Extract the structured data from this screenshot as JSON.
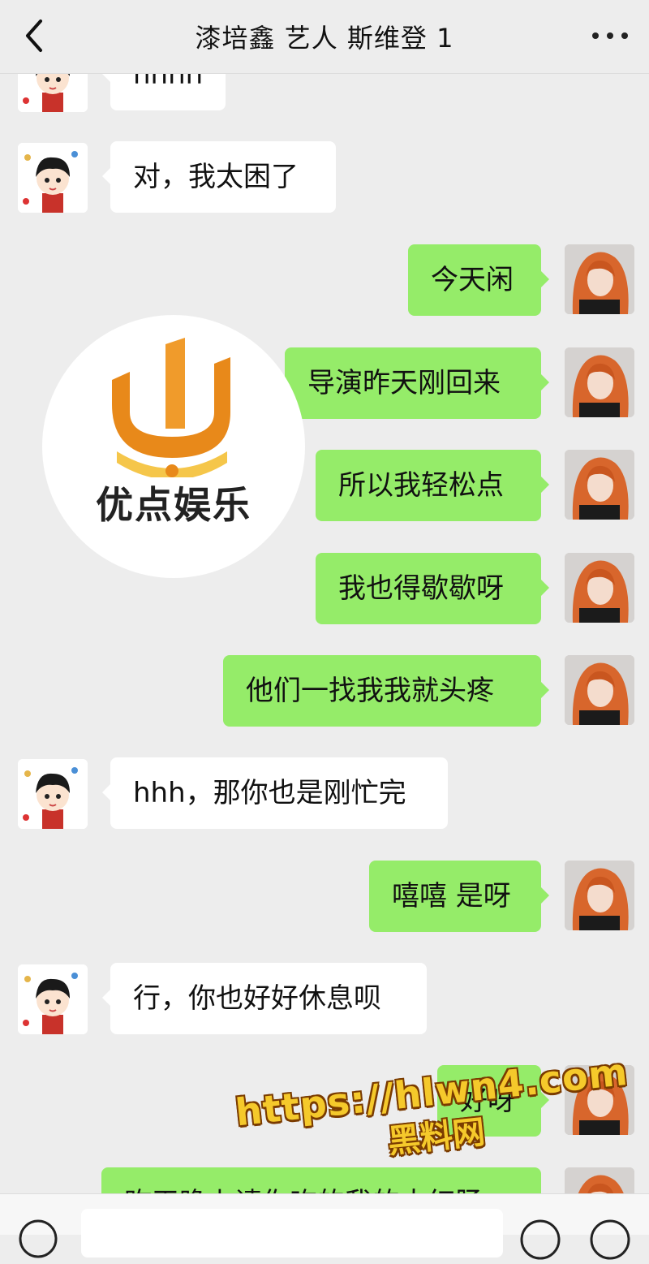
{
  "header": {
    "title": "漆培鑫 艺人 斯维登 1",
    "back_icon": "chevron-left-icon",
    "more_icon": "more-dots-icon"
  },
  "messages": [
    {
      "side": "in",
      "text": "hhhh"
    },
    {
      "side": "in",
      "text": "对，我太困了"
    },
    {
      "side": "out",
      "text": "今天闲"
    },
    {
      "side": "out",
      "text": "导演昨天刚回来"
    },
    {
      "side": "out",
      "text": "所以我轻松点"
    },
    {
      "side": "out",
      "text": "我也得歇歇呀"
    },
    {
      "side": "out",
      "text": "他们一找我我就头疼"
    },
    {
      "side": "in",
      "text": "hhh，那你也是刚忙完"
    },
    {
      "side": "out",
      "text": "嘻嘻 是呀"
    },
    {
      "side": "in",
      "text": "行，你也好好休息呗"
    },
    {
      "side": "out",
      "text": "好呀"
    },
    {
      "side": "out",
      "text": "昨天晚上请你吃的我的大红肠"
    }
  ],
  "overlay_logo": {
    "text": "优点娱乐",
    "color": "#e8891a"
  },
  "watermark": {
    "url": "https://hlwn4.com",
    "text": "黑料网"
  },
  "input_bar": {
    "voice_icon": "voice-icon",
    "emoji_icon": "emoji-icon",
    "plus_icon": "plus-icon"
  },
  "colors": {
    "outgoing_bubble": "#95ec69",
    "incoming_bubble": "#ffffff",
    "background": "#ededed"
  }
}
